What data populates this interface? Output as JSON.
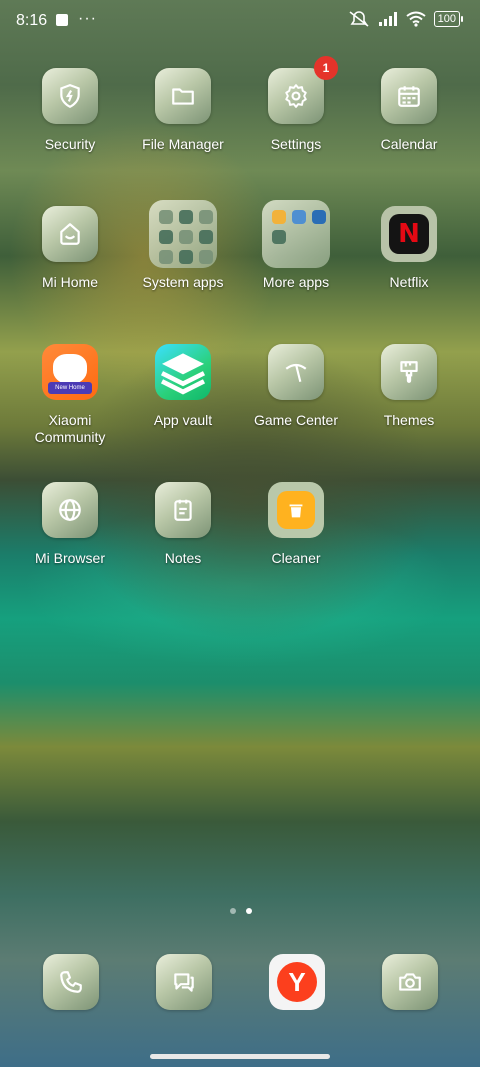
{
  "status_bar": {
    "time": "8:16",
    "battery": "100",
    "icons": [
      "notification-square-icon",
      "more-dots-icon",
      "mute-alarm-icon",
      "signal-icon",
      "wifi-icon",
      "battery-icon"
    ]
  },
  "apps": {
    "security": {
      "label": "Security",
      "icon": "shield-icon"
    },
    "file_manager": {
      "label": "File Manager",
      "icon": "folder-icon"
    },
    "settings": {
      "label": "Settings",
      "icon": "gear-icon",
      "badge": "1"
    },
    "calendar": {
      "label": "Calendar",
      "icon": "calendar-icon"
    },
    "mi_home": {
      "label": "Mi Home",
      "icon": "home-icon"
    },
    "system_apps": {
      "label": "System apps",
      "icon": "folder-grid"
    },
    "more_apps": {
      "label": "More apps",
      "icon": "folder-grid"
    },
    "netflix": {
      "label": "Netflix",
      "icon": "netflix-icon",
      "letter": "N"
    },
    "xiaomi_community": {
      "label": "Xiaomi Community",
      "icon": "community-icon",
      "inner_text": "New Home"
    },
    "app_vault": {
      "label": "App vault",
      "icon": "layers-icon"
    },
    "game_center": {
      "label": "Game Center",
      "icon": "game-icon"
    },
    "themes": {
      "label": "Themes",
      "icon": "brush-icon"
    },
    "mi_browser": {
      "label": "Mi Browser",
      "icon": "globe-icon"
    },
    "notes": {
      "label": "Notes",
      "icon": "notes-icon"
    },
    "cleaner": {
      "label": "Cleaner",
      "icon": "trash-icon"
    }
  },
  "pager": {
    "pages": 2,
    "active_index": 1
  },
  "dock": [
    {
      "name": "phone",
      "icon": "phone-icon"
    },
    {
      "name": "messages",
      "icon": "messages-icon"
    },
    {
      "name": "yandex-browser",
      "icon": "yandex-icon",
      "letter": "Y"
    },
    {
      "name": "camera",
      "icon": "camera-icon"
    }
  ]
}
